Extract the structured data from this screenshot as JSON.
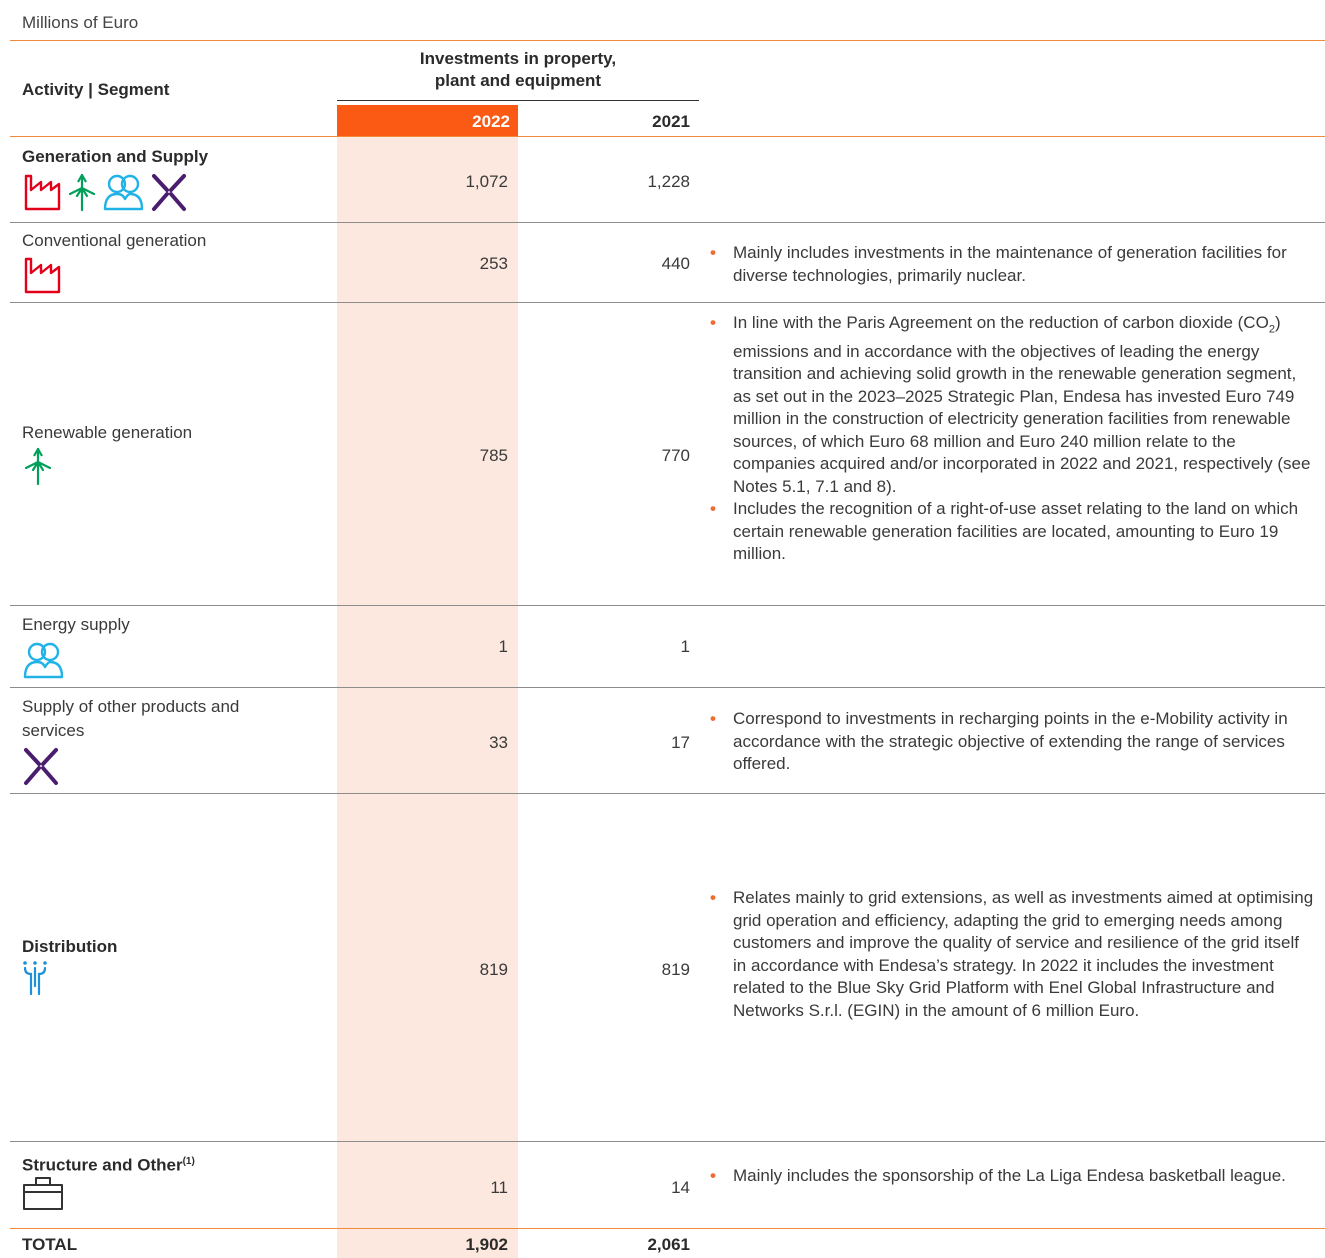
{
  "units": "Millions of Euro",
  "header": {
    "activity": "Activity | Segment",
    "investments": "Investments in property, plant and equipment",
    "year_current": "2022",
    "year_previous": "2021"
  },
  "rows": [
    {
      "label": "Generation and Supply",
      "v2022": "1,072",
      "v2021": "1,228",
      "icons": [
        "factory-icon",
        "wind-turbine-icon",
        "people-icon",
        "cross-arrows-icon"
      ]
    },
    {
      "label": "Conventional generation",
      "v2022": "253",
      "v2021": "440",
      "icons": [
        "factory-icon"
      ],
      "notes": [
        "Mainly includes investments in the maintenance of generation facilities for diverse technologies, primarily nuclear."
      ]
    },
    {
      "label": "Renewable generation",
      "v2022": "785",
      "v2021": "770",
      "icons": [
        "wind-turbine-icon"
      ],
      "notes": [
        "In line with the Paris Agreement on the reduction of carbon dioxide (CO2) emissions and in accordance with the objectives of leading the energy transition and achieving solid growth in the renewable generation segment, as set out in the 2023–2025 Strategic Plan, Endesa has invested Euro 749 million in the construction of electricity generation facilities from renewable sources, of which Euro 68 million and Euro 240 million relate to the companies acquired and/or incorporated in 2022 and 2021, respectively (see Notes 5.1, 7.1 and 8).",
        "Includes the recognition of a right-of-use asset relating to the land on which certain renewable generation facilities are located, amounting to Euro 19 million."
      ]
    },
    {
      "label": "Energy supply",
      "v2022": "1",
      "v2021": "1",
      "icons": [
        "people-icon"
      ]
    },
    {
      "label": "Supply of other products and services",
      "v2022": "33",
      "v2021": "17",
      "icons": [
        "cross-arrows-icon"
      ],
      "notes": [
        "Correspond to investments in recharging points in the e-Mobility activity in accordance with the strategic objective of extending the range of services offered."
      ]
    },
    {
      "label": "Distribution",
      "v2022": "819",
      "v2021": "819",
      "icons": [
        "power-pylon-icon"
      ],
      "notes": [
        "Relates mainly to grid extensions, as well as investments aimed at optimising grid operation and efficiency, adapting the grid to emerging needs among customers and improve the quality of service and resilience of the grid itself in accordance with Endesa’s strategy. In 2022 it includes the investment related to the Blue Sky Grid Platform with Enel Global Infrastructure and Networks S.r.l. (EGIN) in the amount of 6 million Euro."
      ]
    },
    {
      "label": "Structure and Other",
      "label_sup": "(1)",
      "v2022": "11",
      "v2021": "14",
      "icons": [
        "briefcase-icon"
      ],
      "notes": [
        "Mainly includes the sponsorship of the La Liga Endesa basketball league."
      ]
    }
  ],
  "total": {
    "label": "TOTAL",
    "v2022": "1,902",
    "v2021": "2,061"
  },
  "colors": {
    "accent": "#fb5a14",
    "column_tint": "#fde8e0",
    "rule": "#f08a3c",
    "factory": "#e3001b",
    "wind": "#00a05a",
    "people": "#22b3e6",
    "cross": "#4a1d6e",
    "pylon": "#1f8fd8"
  }
}
